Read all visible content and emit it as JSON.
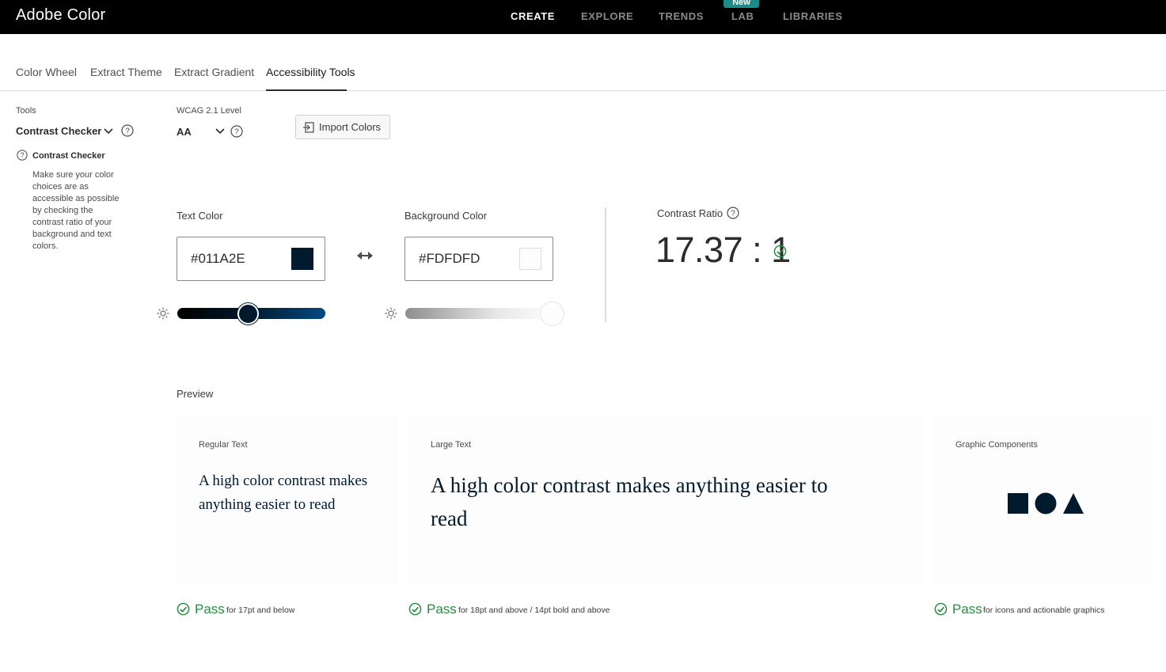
{
  "app": {
    "title": "Adobe Color"
  },
  "nav": {
    "items": [
      "CREATE",
      "EXPLORE",
      "TRENDS",
      "LAB",
      "LIBRARIES"
    ],
    "active": "CREATE",
    "badge": "New"
  },
  "tabs": {
    "items": [
      "Color Wheel",
      "Extract Theme",
      "Extract Gradient",
      "Accessibility Tools"
    ],
    "active": "Accessibility Tools"
  },
  "sidebar": {
    "tools_label": "Tools",
    "tool_selected": "Contrast Checker",
    "info_title": "Contrast Checker",
    "info_body": "Make sure your color choices are as accessible as possible by checking the contrast ratio of your background and text colors."
  },
  "wcag": {
    "label": "WCAG 2.1 Level",
    "value": "AA"
  },
  "import_button": {
    "label": "Import Colors"
  },
  "text_color": {
    "label": "Text Color",
    "hex": "#011A2E",
    "brightness": 0.48
  },
  "background_color": {
    "label": "Background Color",
    "hex": "#FDFDFD",
    "brightness": 0.99
  },
  "contrast": {
    "label": "Contrast Ratio",
    "value": "17.37 : 1"
  },
  "preview": {
    "label": "Preview",
    "regular": {
      "title": "Regular Text",
      "sample": "A high color contrast makes anything easier to read",
      "result": "Pass",
      "note": "for 17pt and below"
    },
    "large": {
      "title": "Large Text",
      "sample": "A high color contrast makes anything easier to read",
      "result": "Pass",
      "note": "for 18pt and above / 14pt bold and above"
    },
    "graphic": {
      "title": "Graphic Components",
      "result": "Pass",
      "note": "for icons and actionable graphics"
    }
  },
  "colors": {
    "topbar": "#000000",
    "pass_green": "#268e42",
    "badge": "#1d8b8a",
    "text_swatch": "#011A2E",
    "bg_swatch": "#FDFDFD"
  }
}
